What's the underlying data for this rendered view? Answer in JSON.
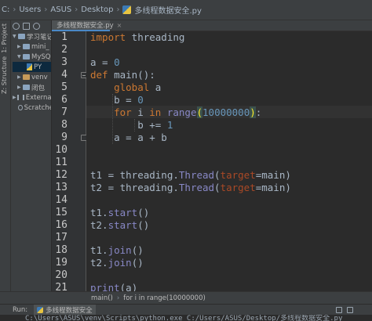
{
  "breadcrumb": {
    "items": [
      "C:",
      "Users",
      "ASUS",
      "Desktop",
      "多线程数据安全.py"
    ]
  },
  "editor_tab": {
    "label": "多线程数据安全.py",
    "close": "×"
  },
  "left_strip": {
    "project": "1: Project",
    "structure": "Z: Structure"
  },
  "project_tree": [
    {
      "label": "学习笔记",
      "expanded": true
    },
    {
      "label": "mini_",
      "expanded": false
    },
    {
      "label": "MySQ",
      "expanded": true
    },
    {
      "label": "PY",
      "expanded": false
    },
    {
      "label": "venv",
      "expanded": false
    },
    {
      "label": "闭包",
      "expanded": false
    },
    {
      "label": "External",
      "expanded": false
    },
    {
      "label": "Scratche",
      "expanded": false
    }
  ],
  "code_lines": [
    {
      "n": "1",
      "tokens": [
        [
          "kw",
          "import"
        ],
        [
          "t",
          " threading"
        ]
      ]
    },
    {
      "n": "2",
      "tokens": []
    },
    {
      "n": "3",
      "tokens": [
        [
          "t",
          "a = "
        ],
        [
          "num",
          "0"
        ]
      ]
    },
    {
      "n": "4",
      "tokens": [
        [
          "kw",
          "def"
        ],
        [
          "t",
          " main():"
        ]
      ]
    },
    {
      "n": "5",
      "tokens": [
        [
          "t",
          "    "
        ],
        [
          "kw",
          "global"
        ],
        [
          "t",
          " a"
        ]
      ]
    },
    {
      "n": "6",
      "tokens": [
        [
          "t",
          "    b = "
        ],
        [
          "num",
          "0"
        ]
      ]
    },
    {
      "n": "7",
      "tokens": [
        [
          "t",
          "    "
        ],
        [
          "kw",
          "for"
        ],
        [
          "t",
          " i "
        ],
        [
          "kw",
          "in"
        ],
        [
          "t",
          " "
        ],
        [
          "bi",
          "range"
        ],
        [
          "brace",
          "("
        ],
        [
          "num",
          "10000000"
        ],
        [
          "brace",
          ")"
        ],
        [
          "t",
          ":"
        ]
      ]
    },
    {
      "n": "8",
      "tokens": [
        [
          "t",
          "        b += "
        ],
        [
          "num",
          "1"
        ]
      ]
    },
    {
      "n": "9",
      "tokens": [
        [
          "t",
          "    a = a + b"
        ]
      ]
    },
    {
      "n": "10",
      "tokens": []
    },
    {
      "n": "11",
      "tokens": []
    },
    {
      "n": "12",
      "tokens": [
        [
          "t",
          "t1 = threading."
        ],
        [
          "bi",
          "Thread"
        ],
        [
          "t",
          "("
        ],
        [
          "kwarg",
          "target"
        ],
        [
          "t",
          "=main)"
        ]
      ]
    },
    {
      "n": "13",
      "tokens": [
        [
          "t",
          "t2 = threading."
        ],
        [
          "bi",
          "Thread"
        ],
        [
          "t",
          "("
        ],
        [
          "kwarg",
          "target"
        ],
        [
          "t",
          "=main)"
        ]
      ]
    },
    {
      "n": "14",
      "tokens": []
    },
    {
      "n": "15",
      "tokens": [
        [
          "t",
          "t1."
        ],
        [
          "bi",
          "start"
        ],
        [
          "t",
          "()"
        ]
      ]
    },
    {
      "n": "16",
      "tokens": [
        [
          "t",
          "t2."
        ],
        [
          "bi",
          "start"
        ],
        [
          "t",
          "()"
        ]
      ]
    },
    {
      "n": "17",
      "tokens": []
    },
    {
      "n": "18",
      "tokens": [
        [
          "t",
          "t1."
        ],
        [
          "bi",
          "join"
        ],
        [
          "t",
          "()"
        ]
      ]
    },
    {
      "n": "19",
      "tokens": [
        [
          "t",
          "t2."
        ],
        [
          "bi",
          "join"
        ],
        [
          "t",
          "()"
        ]
      ]
    },
    {
      "n": "20",
      "tokens": []
    },
    {
      "n": "21",
      "tokens": [
        [
          "bi",
          "print"
        ],
        [
          "t",
          "(a)"
        ]
      ]
    }
  ],
  "current_line": "7",
  "navbar": {
    "items": [
      "main()",
      "for i in range(10000000)"
    ]
  },
  "run": {
    "label": "Run:",
    "tab": "多线程数据安全",
    "output": "C:\\Users\\ASUS\\venv\\Scripts\\python.exe C:/Users/ASUS/Desktop/多线程数据安全.py"
  },
  "colors": {
    "background": "#2b2b2b",
    "keyword": "#cc7832",
    "number": "#6897bb",
    "builtin": "#8888c6",
    "kwarg": "#aa4926",
    "text": "#a9b7c6",
    "brace_match": "#ffef28"
  }
}
